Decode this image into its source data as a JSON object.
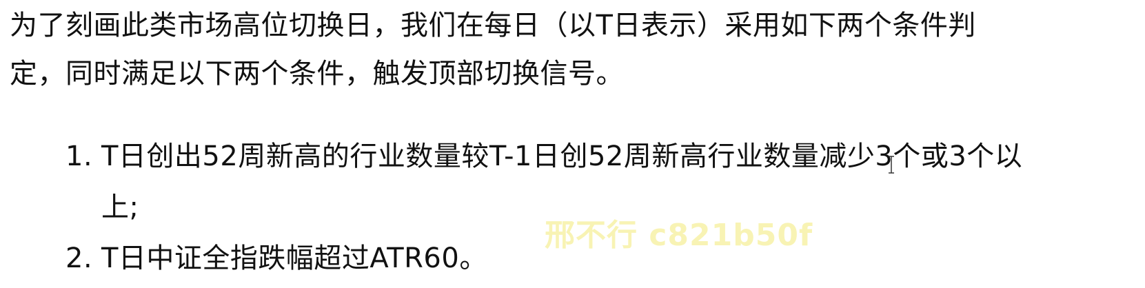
{
  "document": {
    "intro_line_1": "为了刻画此类市场高位切换日，我们在每日（以T日表示）采用如下两个条件判",
    "intro_line_2": "定，同时满足以下两个条件，触发顶部切换信号。",
    "conditions": [
      {
        "marker": "1.",
        "line_1": "T日创出52周新高的行业数量较T-1日创52周新高行业数量减少3个或3个以",
        "line_2": "上;"
      },
      {
        "marker": "2.",
        "line_1": "T日中证全指跌幅超过ATR60。"
      }
    ]
  },
  "watermark": {
    "text": "邢不行 c821b50f",
    "color": "#f7f2a8"
  },
  "cursor": {
    "icon": "text-cursor-icon"
  }
}
